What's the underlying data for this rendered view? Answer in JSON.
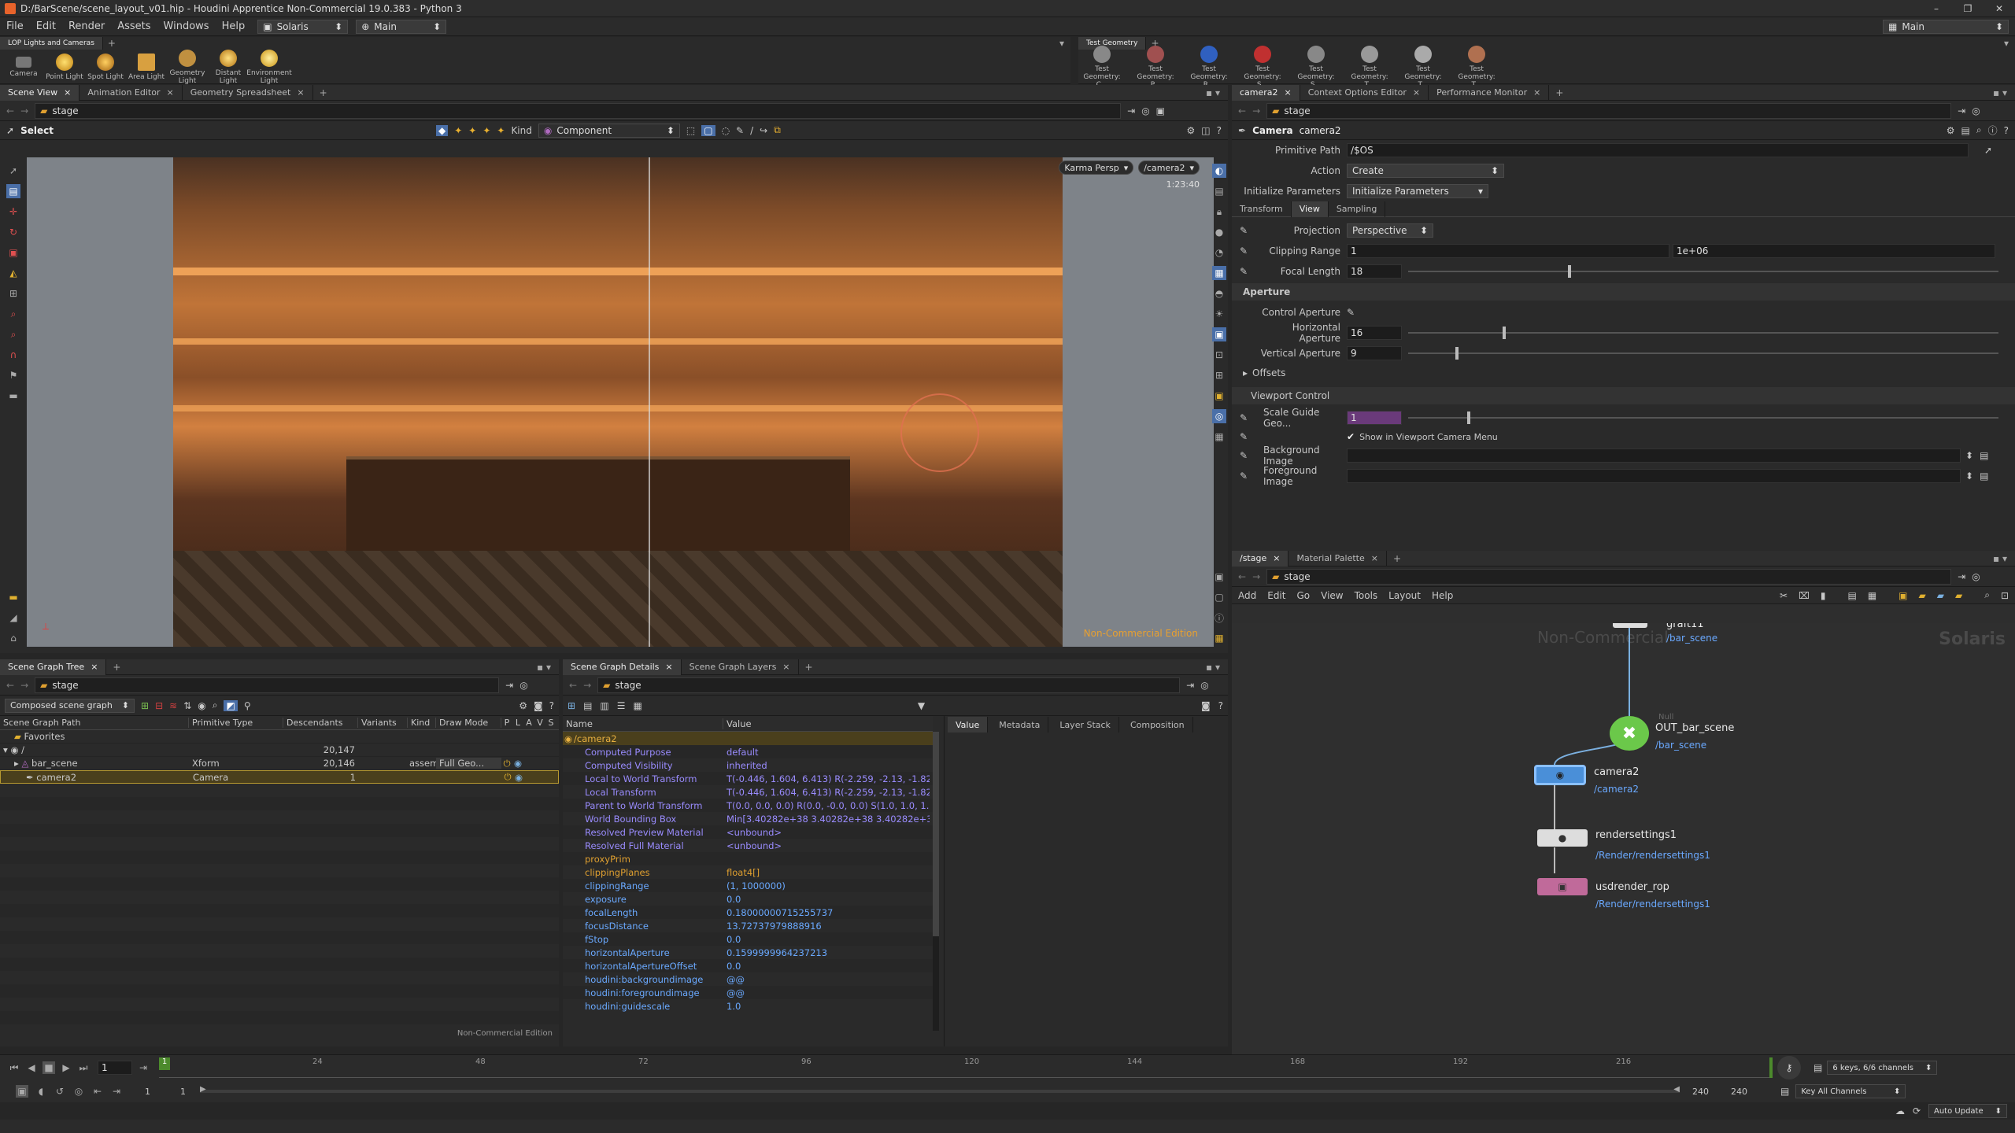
{
  "window": {
    "title": "D:/BarScene/scene_layout_v01.hip - Houdini Apprentice Non-Commercial 19.0.383 - Python 3"
  },
  "menu": {
    "items": [
      "File",
      "Edit",
      "Render",
      "Assets",
      "Windows",
      "Help"
    ],
    "desktop": "Solaris",
    "context": "Main",
    "right_context": "Main"
  },
  "shelf_left": {
    "tab": "LOP Lights and Cameras",
    "tools": [
      "Camera",
      "Point Light",
      "Spot Light",
      "Area Light",
      "Geometry Light",
      "Distant Light",
      "Environment Light"
    ]
  },
  "shelf_right": {
    "tab": "Test Geometry",
    "tools": [
      "Test Geometry: C...",
      "Test Geometry: P...",
      "Test Geometry: R...",
      "Test Geometry: S...",
      "Test Geometry: S...",
      "Test Geometry: T...",
      "Test Geometry: T...",
      "Test Geometry: T..."
    ]
  },
  "viewer": {
    "tabs": [
      "Scene View",
      "Animation Editor",
      "Geometry Spreadsheet"
    ],
    "path": "stage",
    "select_label": "Select",
    "kind_label": "Kind",
    "kind_value": "Component",
    "renderer": "Karma Persp",
    "camera": "/camera2",
    "timecode": "1:23:40",
    "watermark": "Non-Commercial Edition"
  },
  "params": {
    "tabs": [
      "camera2",
      "Context Options Editor",
      "Performance Monitor"
    ],
    "path": "stage",
    "node_type": "Camera",
    "node_name": "camera2",
    "primitive_path_label": "Primitive Path",
    "primitive_path": "/$OS",
    "action_label": "Action",
    "action": "Create",
    "init_label": "Initialize Parameters",
    "init_button": "Initialize Parameters",
    "subtabs": [
      "Transform",
      "View",
      "Sampling"
    ],
    "projection_label": "Projection",
    "projection": "Perspective",
    "clipping_label": "Clipping Range",
    "clip_near": "1",
    "clip_far": "1e+06",
    "focal_label": "Focal Length",
    "focal": "18",
    "focal_frac": 0.27,
    "aperture_section": "Aperture",
    "control_ap_label": "Control Aperture",
    "hap_label": "Horizontal Aperture",
    "hap": "16",
    "hap_frac": 0.16,
    "vap_label": "Vertical Aperture",
    "vap": "9",
    "vap_frac": 0.08,
    "offsets": "Offsets",
    "viewport_section": "Viewport Control",
    "scale_label": "Scale Guide Geo...",
    "scale": "1",
    "scale_frac": 0.1,
    "show_menu_label": "Show in Viewport Camera Menu",
    "bg_label": "Background Image",
    "fg_label": "Foreground Image"
  },
  "network": {
    "tabs": [
      "/stage",
      "Material Palette"
    ],
    "path": "stage",
    "menu": [
      "Add",
      "Edit",
      "Go",
      "View",
      "Tools",
      "Layout",
      "Help"
    ],
    "watermark": "Non-Commercial",
    "context_label": "Solaris",
    "nodes": [
      {
        "name": "graft11",
        "path": "/bar_scene"
      },
      {
        "type": "Null",
        "name": "OUT_bar_scene",
        "path": "/bar_scene"
      },
      {
        "name": "camera2",
        "path": "/camera2"
      },
      {
        "name": "rendersettings1",
        "path": "/Render/rendersettings1"
      },
      {
        "name": "usdrender_rop",
        "path": "/Render/rendersettings1"
      }
    ]
  },
  "scene_tree": {
    "tabs": [
      "Scene Graph Tree"
    ],
    "path": "stage",
    "mode": "Composed scene graph",
    "columns": [
      "Scene Graph Path",
      "Primitive Type",
      "Descendants",
      "Variants",
      "Kind",
      "Draw Mode",
      "P",
      "L",
      "A",
      "V",
      "S"
    ],
    "rows": [
      {
        "path": "Favorites",
        "type": "",
        "desc": "",
        "kind": "",
        "draw": ""
      },
      {
        "path": "/",
        "type": "",
        "desc": "20,147",
        "kind": "",
        "draw": ""
      },
      {
        "path": "bar_scene",
        "type": "Xform",
        "desc": "20,146",
        "kind": "assem",
        "draw": "Full Geo..."
      },
      {
        "path": "camera2",
        "type": "Camera",
        "desc": "1",
        "kind": "",
        "draw": ""
      }
    ],
    "watermark": "Non-Commercial Edition"
  },
  "details": {
    "tabs": [
      "Scene Graph Details",
      "Scene Graph Layers"
    ],
    "path": "stage",
    "columns": [
      "Name",
      "Value"
    ],
    "prim": "/camera2",
    "rows": [
      [
        "Computed Purpose",
        "default"
      ],
      [
        "Computed Visibility",
        "inherited"
      ],
      [
        "Local to World Transform",
        "T(-0.446, 1.604, 6.413) R(-2.259, -2.13, -1.824..."
      ],
      [
        "Local Transform",
        "T(-0.446, 1.604, 6.413) R(-2.259, -2.13, -1.824..."
      ],
      [
        "Parent to World Transform",
        "T(0.0, 0.0, 0.0) R(0.0, -0.0, 0.0) S(1.0, 1.0, 1.0)"
      ],
      [
        "World Bounding Box",
        "Min[3.40282e+38 3.40282e+38 3.40282e+38] ..."
      ],
      [
        "Resolved Preview Material",
        "<unbound>"
      ],
      [
        "Resolved Full Material",
        "<unbound>"
      ],
      [
        "proxyPrim",
        ""
      ],
      [
        "clippingPlanes",
        "float4[]"
      ],
      [
        "clippingRange",
        "(1, 1000000)"
      ],
      [
        "exposure",
        "0.0"
      ],
      [
        "focalLength",
        "0.18000000715255737"
      ],
      [
        "focusDistance",
        "13.72737979888916"
      ],
      [
        "fStop",
        "0.0"
      ],
      [
        "horizontalAperture",
        "0.1599999964237213"
      ],
      [
        "horizontalApertureOffset",
        "0.0"
      ],
      [
        "houdini:backgroundimage",
        "@@"
      ],
      [
        "houdini:foregroundimage",
        "@@"
      ],
      [
        "houdini:guidescale",
        "1.0"
      ]
    ],
    "side_tabs": [
      "Value",
      "Metadata",
      "Layer Stack",
      "Composition"
    ]
  },
  "timeline": {
    "frame": "1",
    "ticks": [
      "24",
      "48",
      "72",
      "96",
      "120",
      "144",
      "168",
      "192",
      "216"
    ],
    "start": "1",
    "start2": "1",
    "end": "240",
    "end2": "240",
    "keys_info": "6 keys, 6/6 channels",
    "channels": "Key All Channels",
    "update": "Auto Update"
  }
}
